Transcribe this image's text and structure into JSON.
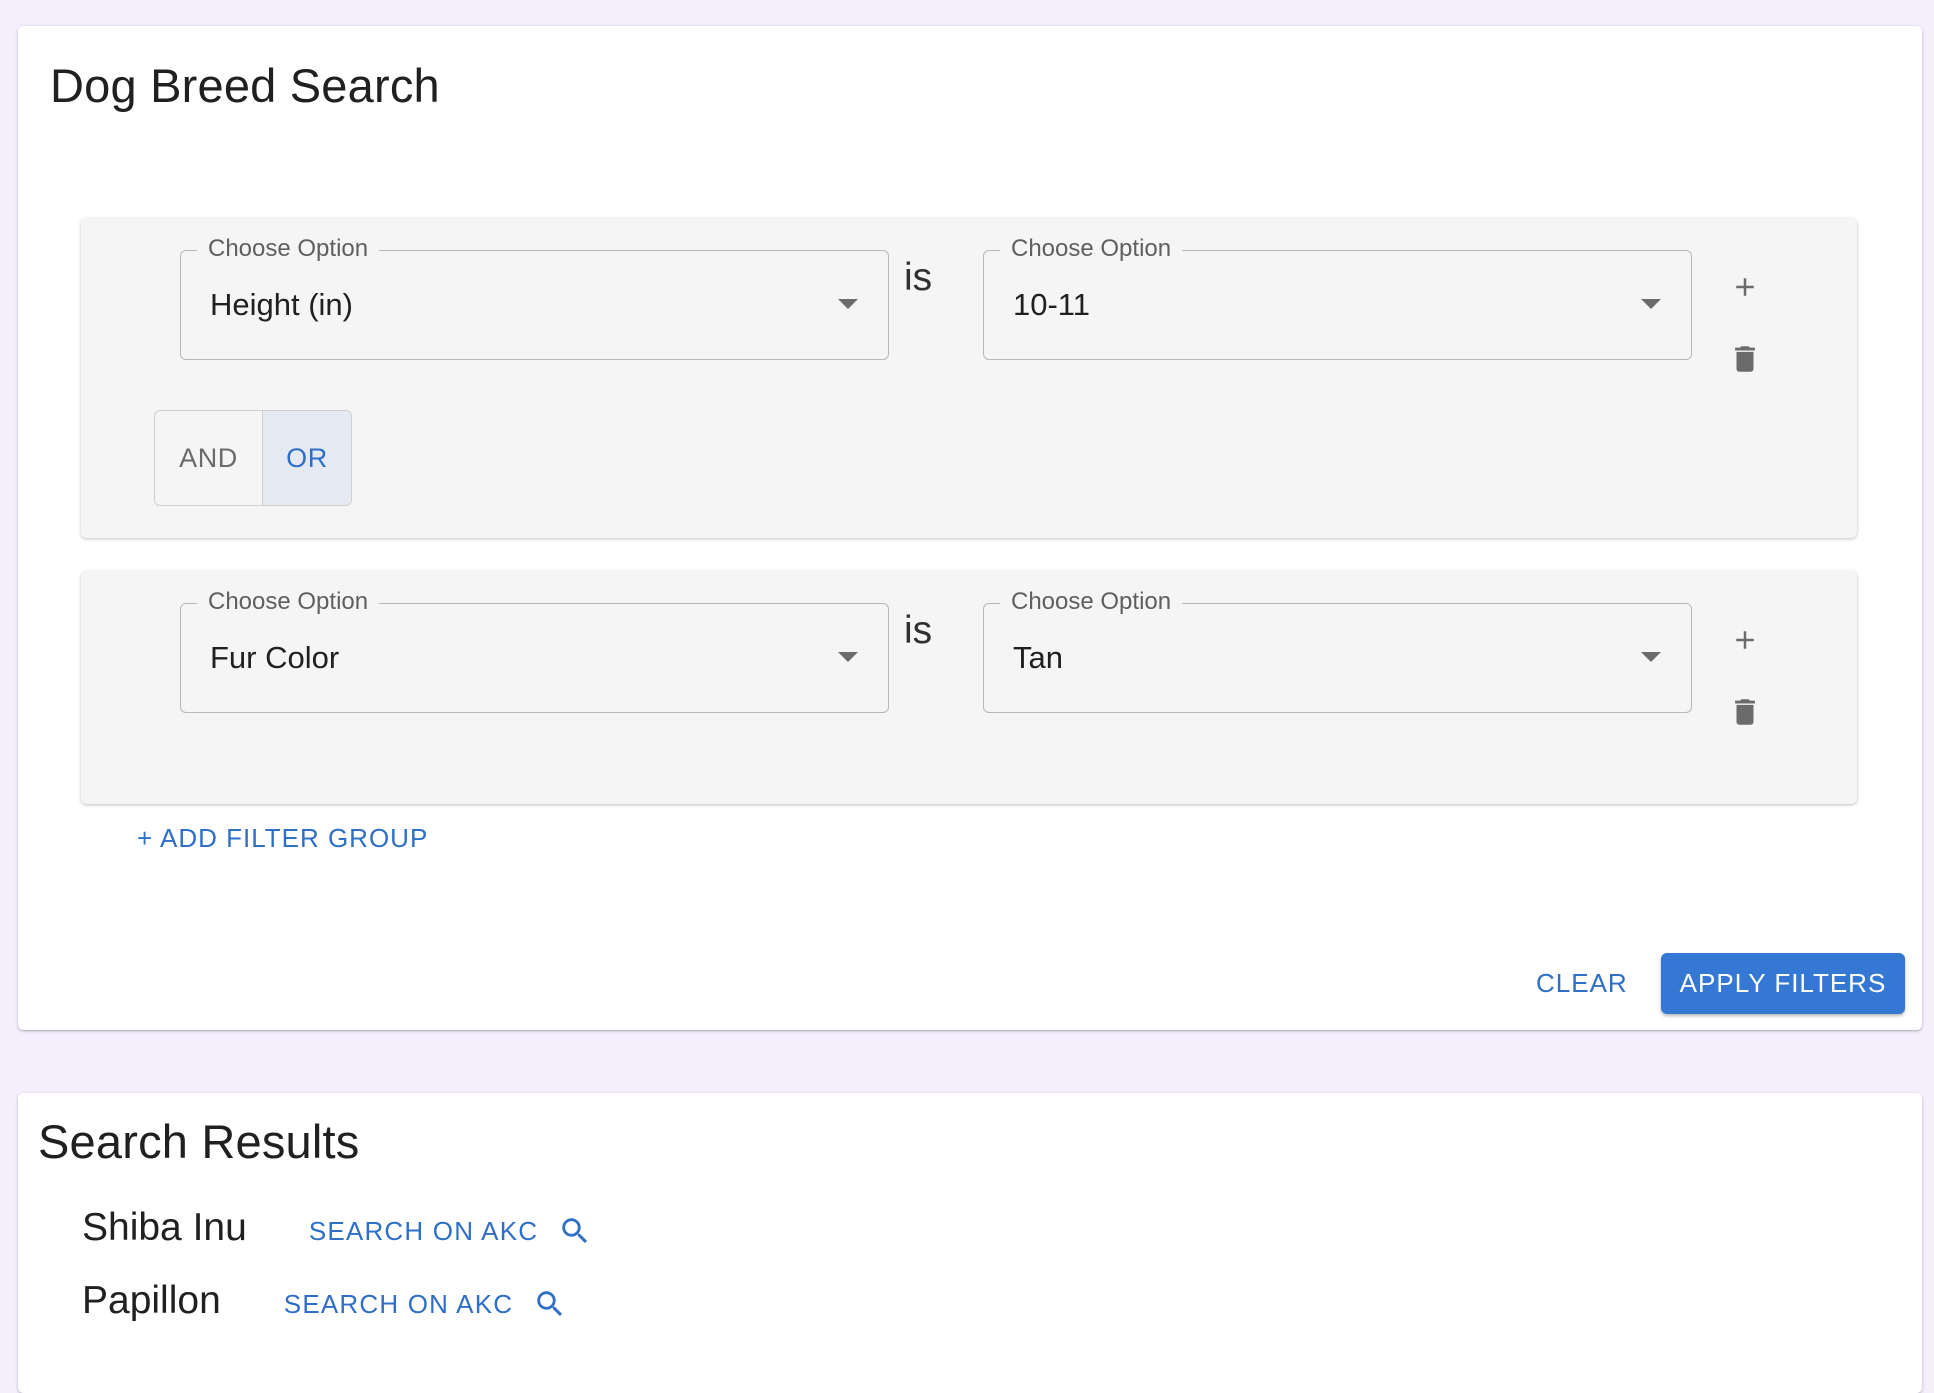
{
  "filter_panel": {
    "title": "Dog Breed Search",
    "groups": [
      {
        "attribute": {
          "label": "Choose Option",
          "value": "Height (in)"
        },
        "operator": "is",
        "value": {
          "label": "Choose Option",
          "value": "10-11"
        },
        "combinator": {
          "options": [
            "AND",
            "OR"
          ],
          "selected": "OR"
        }
      },
      {
        "attribute": {
          "label": "Choose Option",
          "value": "Fur Color"
        },
        "operator": "is",
        "value": {
          "label": "Choose Option",
          "value": "Tan"
        }
      }
    ],
    "add_group_label": "+ ADD FILTER GROUP",
    "clear_label": "CLEAR",
    "apply_label": "APPLY FILTERS"
  },
  "results": {
    "title": "Search Results",
    "items": [
      {
        "name": "Shiba Inu",
        "link_label": "SEARCH ON AKC",
        "icon": "search-icon"
      },
      {
        "name": "Papillon",
        "link_label": "SEARCH ON AKC",
        "icon": "search-icon"
      }
    ]
  },
  "colors": {
    "page_background": "#f5eefd",
    "accent": "#3478d3",
    "link": "#2f6fc8",
    "group_background": "#f5f5f5",
    "toggle_selected_bg": "#e5eaf2"
  },
  "icons": [
    "add-icon",
    "delete-icon",
    "dropdown-arrow-icon",
    "search-icon"
  ]
}
